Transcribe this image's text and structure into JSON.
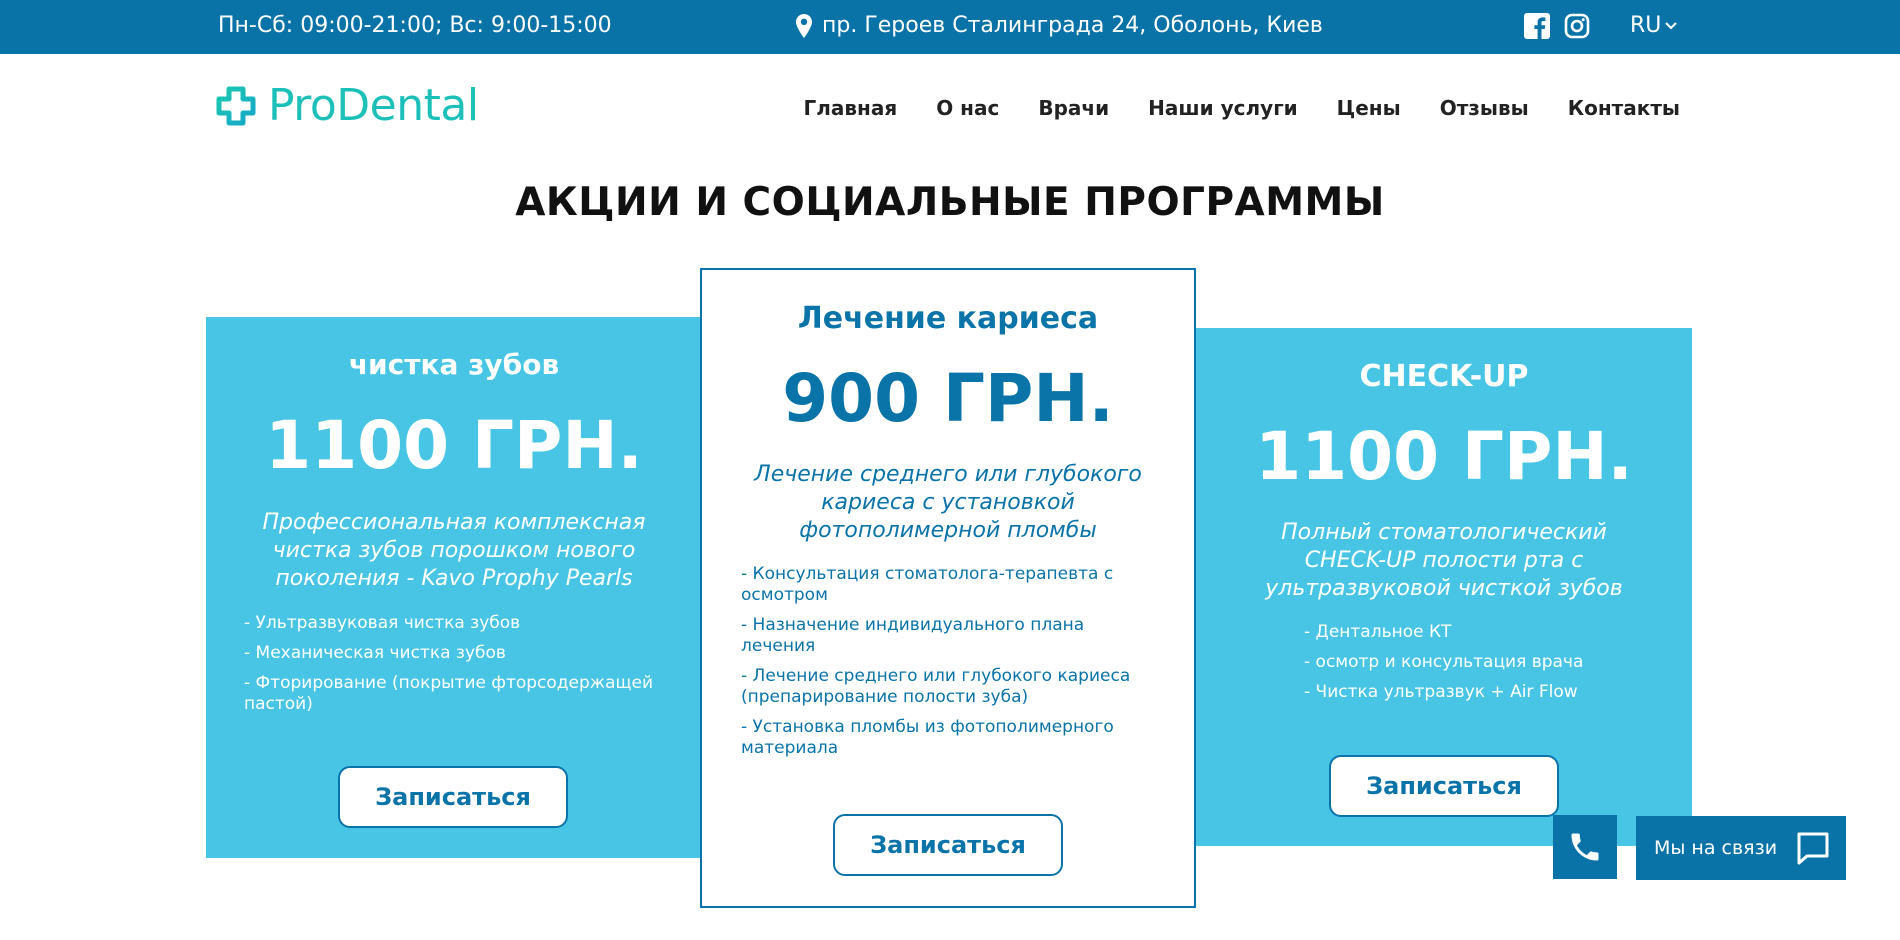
{
  "topbar": {
    "hours": "Пн-Сб: 09:00-21:00; Вс: 9:00-15:00",
    "address": "пр. Героев Сталинграда 24, Оболонь, Киев",
    "social_icons": [
      "facebook-icon",
      "instagram-icon"
    ],
    "language": "RU"
  },
  "logo": {
    "text": "ProDental"
  },
  "nav": {
    "items": [
      "Главная",
      "О нас",
      "Врачи",
      "Наши услуги",
      "Цены",
      "Отзывы",
      "Контакты"
    ]
  },
  "section": {
    "title": "АКЦИИ И СОЦИАЛЬНЫЕ ПРОГРАММЫ"
  },
  "cards": [
    {
      "title": "чистка зубов",
      "price": "1100 ГРН.",
      "description": "Профессиональная комплексная чистка зубов порошком нового поколения - Kavo Prophy Pearls",
      "items": [
        "- Ультразвуковая чистка зубов",
        "- Механическая чистка зубов",
        "- Фторирование (покрытие фторсодержащей пастой)"
      ],
      "button": "Записаться"
    },
    {
      "title": "Лечение кариеса",
      "price": "900 ГРН.",
      "description": "Лечение среднего или глубокого кариеса с установкой фотополимерной пломбы",
      "items": [
        "- Консультация стоматолога-терапевта с осмотром",
        "- Назначение индивидуального плана лечения",
        "- Лечение среднего или глубокого кариеса (препарирование полости зуба)",
        "- Установка пломбы из фотополимерного материала"
      ],
      "button": "Записаться"
    },
    {
      "title": "CHECK-UP",
      "price": "1100 ГРН.",
      "description": "Полный стоматологический CHECK-UP полости рта с ультразвуковой чисткой зубов",
      "items": [
        "- Дентальное КТ",
        "- осмотр и консультация врача",
        "- Чистка ультразвук + Air Flow"
      ],
      "button": "Записаться"
    }
  ],
  "contact_widget": {
    "label": "Мы на связи"
  },
  "colors": {
    "primary": "#0973a8",
    "card_blue": "#48c5e4",
    "logo": "#1cc0b8"
  }
}
